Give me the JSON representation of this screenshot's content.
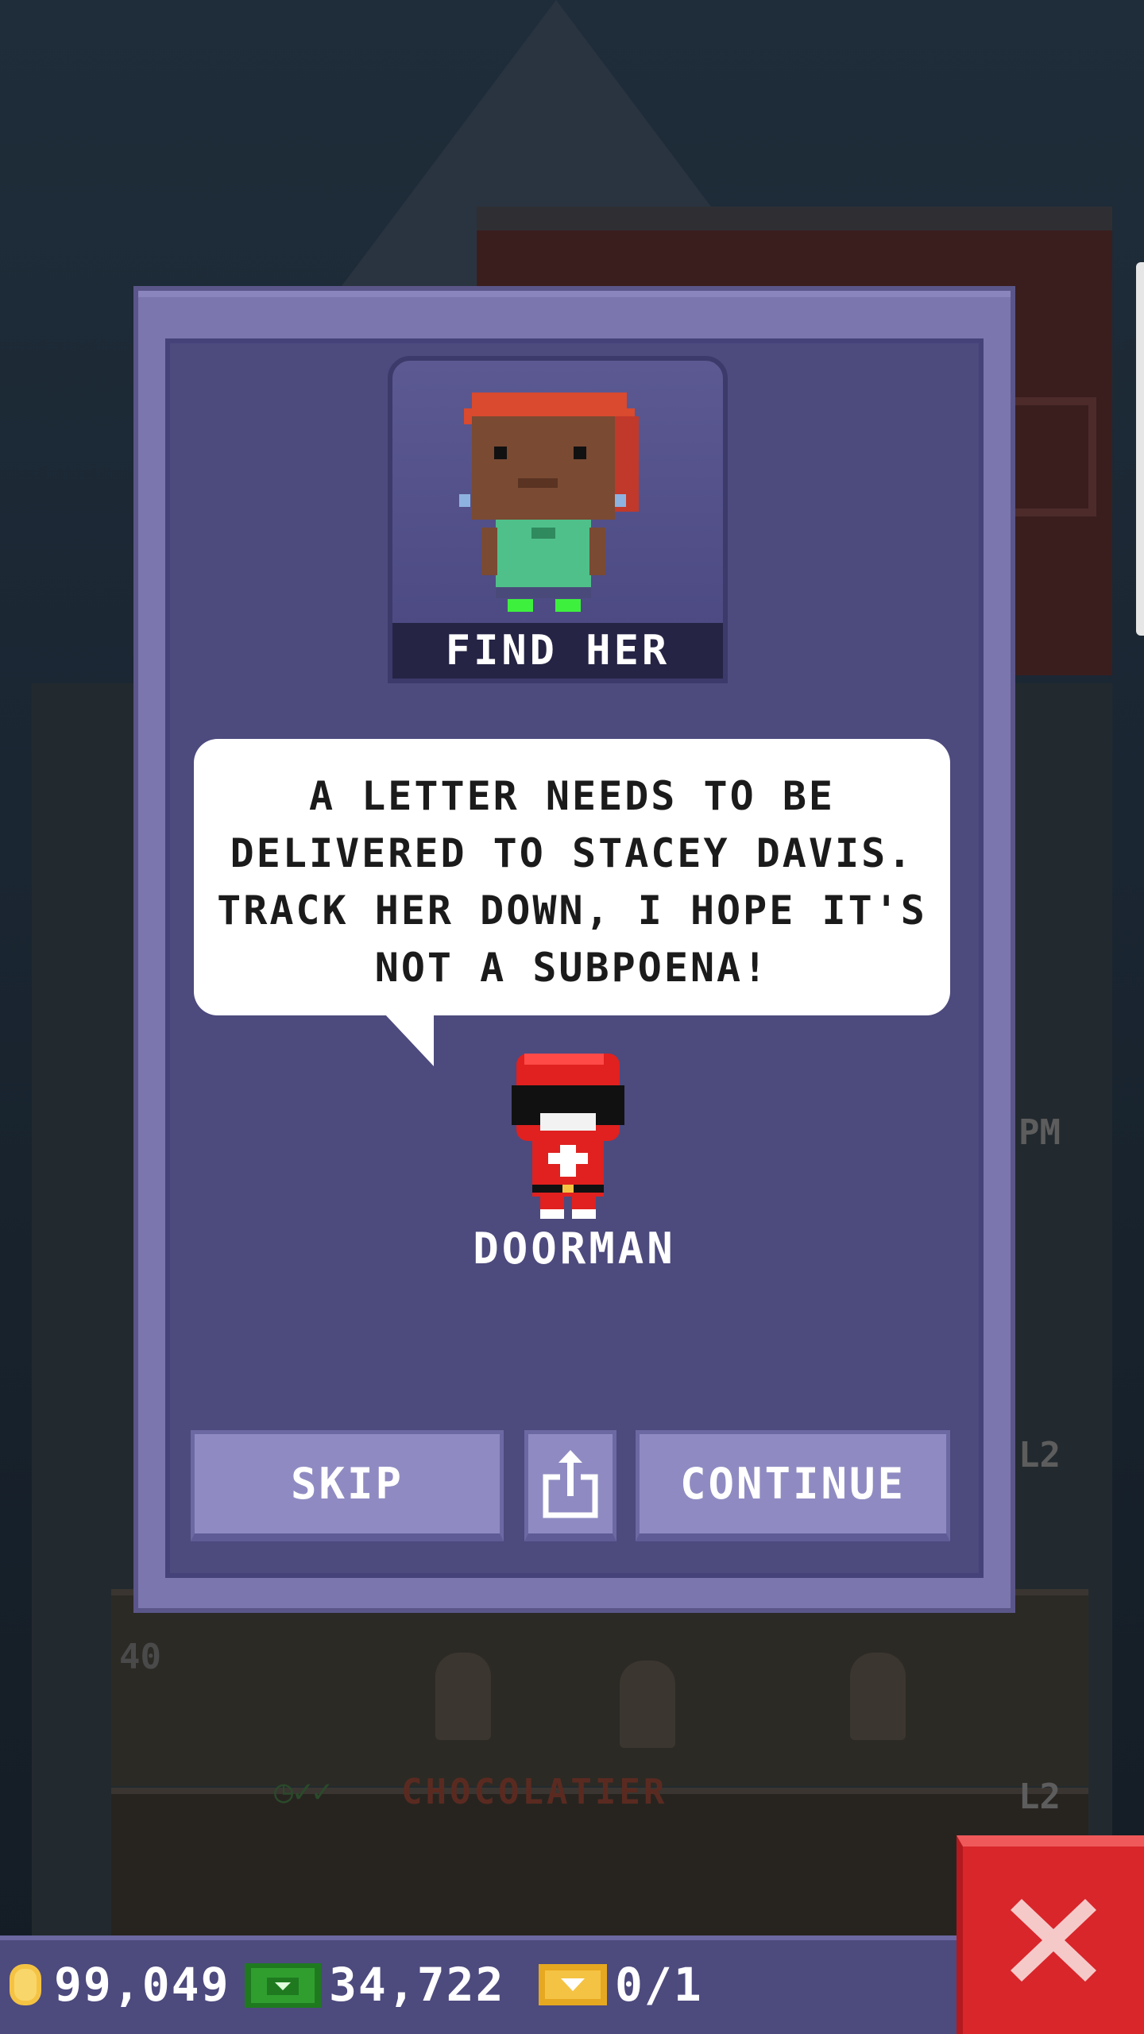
{
  "mission": {
    "title": "FIND HER",
    "message": "A LETTER NEEDS TO BE DELIVERED TO STACEY DAVIS. TRACK HER DOWN, I HOPE IT'S NOT A SUBPOENA!",
    "speaker": "DOORMAN"
  },
  "buttons": {
    "skip": "SKIP",
    "continue": "CONTINUE",
    "share_icon": "share-icon",
    "close_icon": "close-icon"
  },
  "hud": {
    "coins": "99,049",
    "coins_icon": "coin-icon",
    "bux": "34,722",
    "bux_icon": "tower-bux-icon",
    "tickets": "0/1",
    "tickets_icon": "golden-ticket-icon"
  },
  "background": {
    "floor_name": "CHOCOLATIER",
    "floor_number": "40",
    "level_tag": "L2",
    "other_tag": "PM"
  },
  "colors": {
    "dialog_bg": "#4d4a7e",
    "button_bg": "#8f8bc2",
    "close_red": "#d8262b",
    "coin_gold": "#f5c343",
    "bux_green": "#2f9e2f"
  }
}
